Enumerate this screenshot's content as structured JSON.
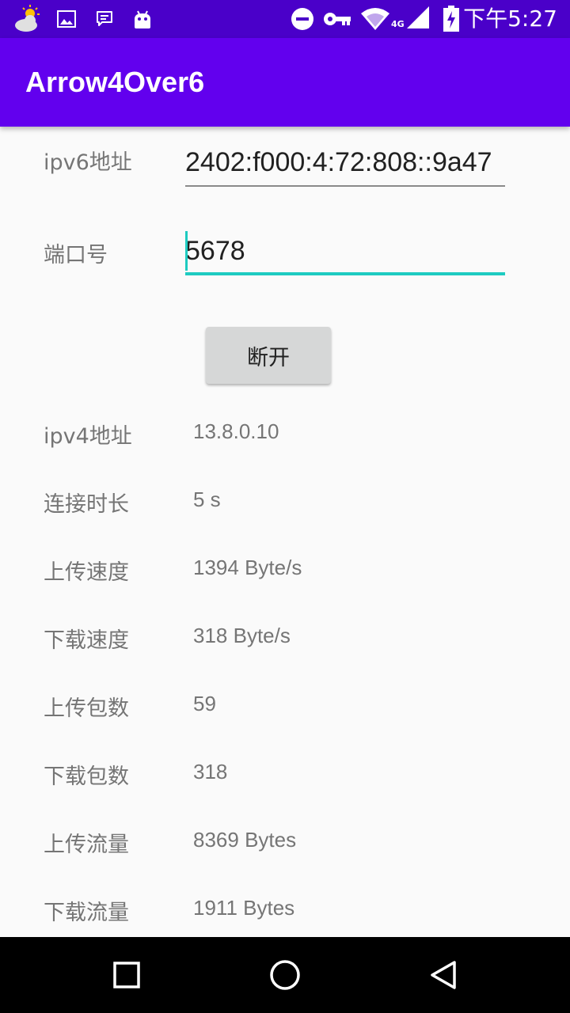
{
  "status_bar": {
    "time": "下午5:27",
    "network_label": "4G",
    "icons": [
      "weather-icon",
      "gallery-icon",
      "message-icon",
      "android-icon",
      "do-not-disturb-icon",
      "vpn-key-icon",
      "wifi-icon",
      "signal-icon",
      "battery-icon"
    ]
  },
  "app_bar": {
    "title": "Arrow4Over6"
  },
  "form": {
    "ipv6_label": "ipv6地址",
    "ipv6_value": "2402:f000:4:72:808::9a47",
    "port_label": "端口号",
    "port_value": "5678",
    "button_label": "断开"
  },
  "stats": [
    {
      "label": "ipv4地址",
      "value": "13.8.0.10"
    },
    {
      "label": "连接时长",
      "value": "5 s"
    },
    {
      "label": "上传速度",
      "value": "1394 Byte/s"
    },
    {
      "label": "下载速度",
      "value": "318 Byte/s"
    },
    {
      "label": "上传包数",
      "value": "59"
    },
    {
      "label": "下载包数",
      "value": "318"
    },
    {
      "label": "上传流量",
      "value": "8369 Bytes"
    },
    {
      "label": "下载流量",
      "value": "1911 Bytes"
    }
  ],
  "nav_bar": {
    "icons": [
      "recents-icon",
      "home-icon",
      "back-icon"
    ]
  },
  "colors": {
    "status_bar": "#4a00c9",
    "app_bar": "#6200ee",
    "accent": "#1ecbc1",
    "background": "#fafafa",
    "button": "#d6d7d7"
  }
}
